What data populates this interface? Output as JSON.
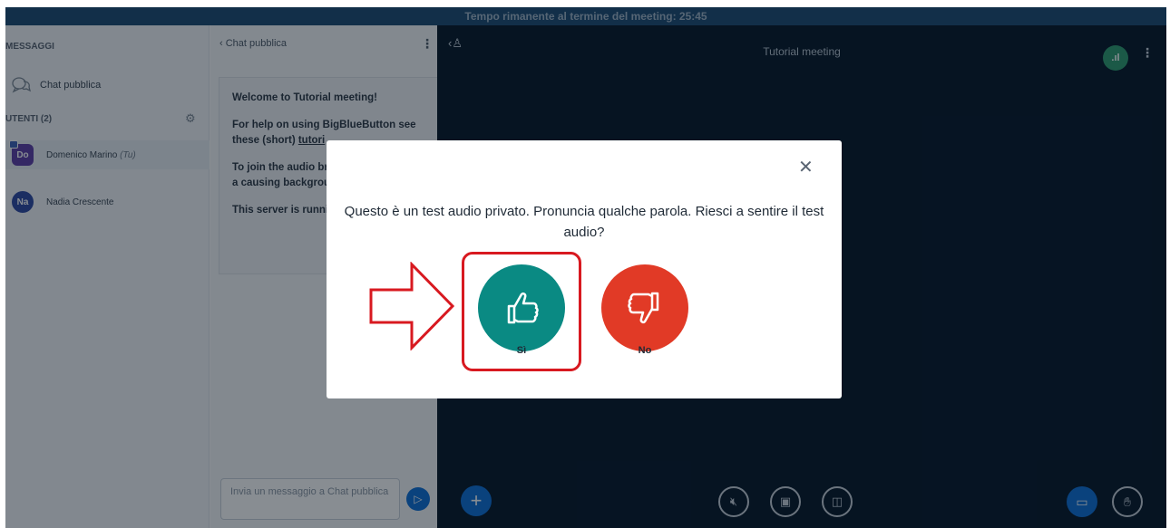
{
  "topbar": {
    "remaining": "Tempo rimanente al termine del meeting: 25:45"
  },
  "sidebar": {
    "messages_title": "MESSAGGI",
    "public_chat": "Chat pubblica",
    "users_title": "UTENTI (2)",
    "users": [
      {
        "initials": "Do",
        "name": "Domenico Marino",
        "you": "(Tu)"
      },
      {
        "initials": "Na",
        "name": "Nadia Crescente"
      }
    ]
  },
  "chat": {
    "header": "Chat pubblica",
    "welcome_title": "Welcome to Tutorial meeting!",
    "welcome_help_1": "For help on using BigBlueButton see these (short) ",
    "welcome_help_link": "tutori",
    "welcome_audio": "To join the audio br phone button. Use a causing background",
    "welcome_server": "This server is runni",
    "input_placeholder": "Invia un messaggio a Chat pubblica"
  },
  "main": {
    "title": "Tutorial meeting"
  },
  "modal": {
    "question": "Questo è un test audio privato. Pronuncia qualche parola. Riesci a sentire il test audio?",
    "yes_label": "Sì",
    "no_label": "No"
  },
  "colors": {
    "topbar": "#1e4b73",
    "main_bg": "#06172a",
    "primary_blue": "#0f70d7",
    "yes_green": "#0a8a83",
    "no_red": "#e13a26",
    "annotation_red": "#d81920"
  }
}
